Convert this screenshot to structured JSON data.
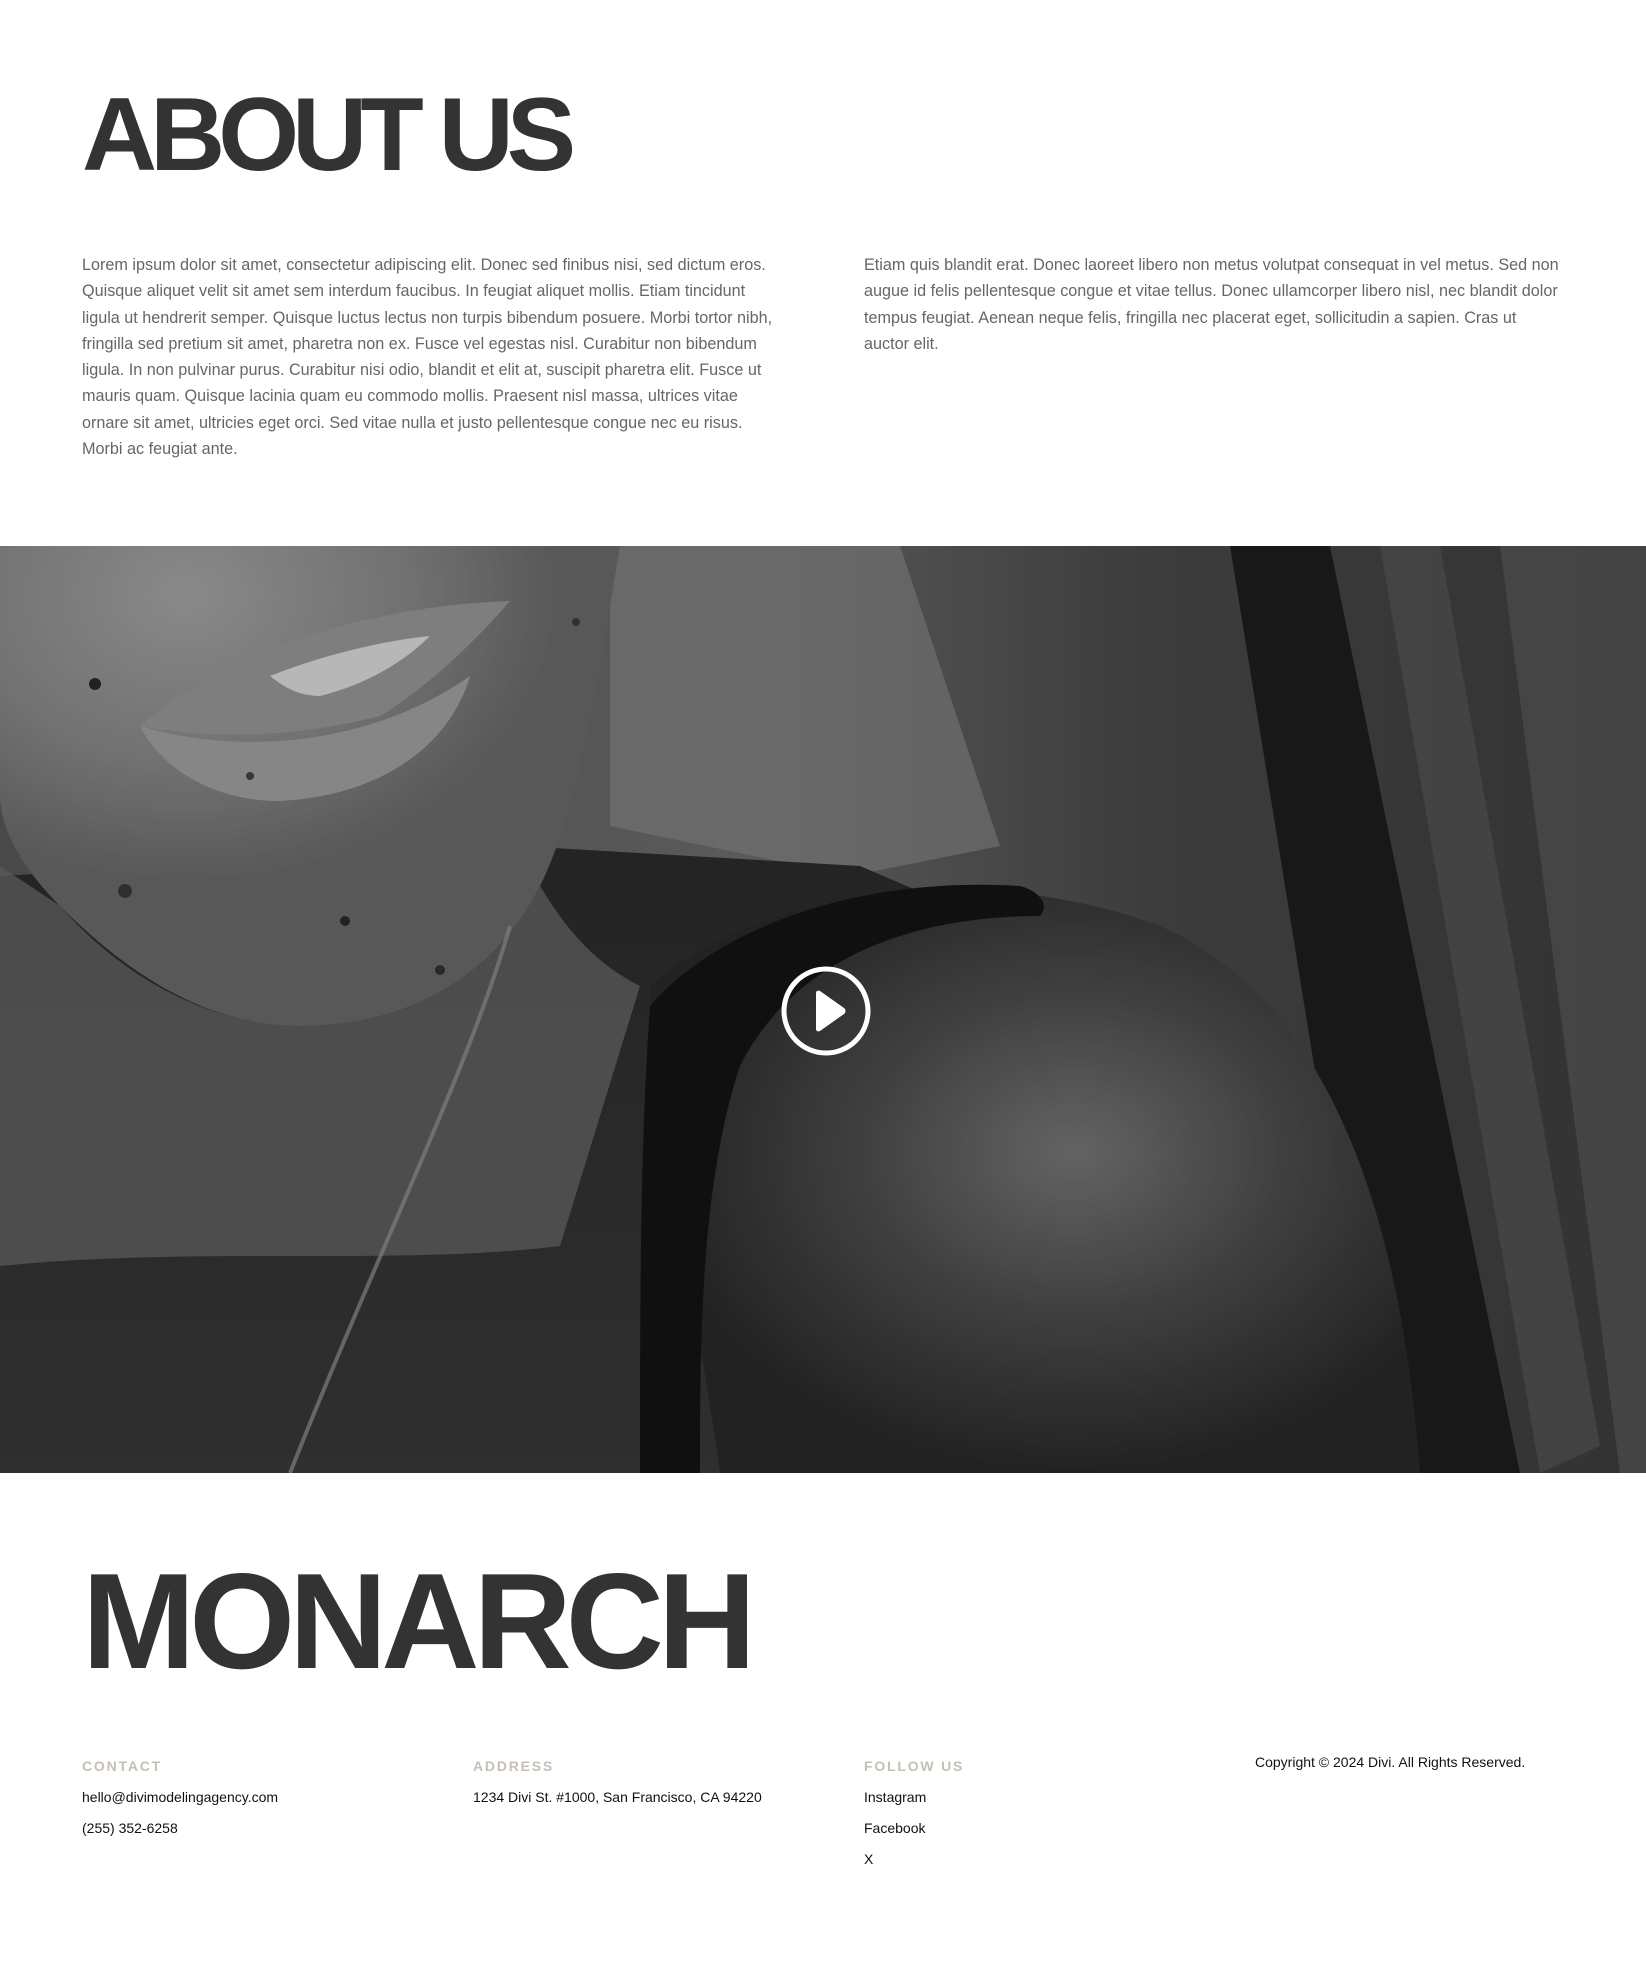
{
  "about": {
    "title": "ABOUT US",
    "left_paragraph": "Lorem ipsum dolor sit amet, consectetur adipiscing elit. Donec sed finibus nisi, sed dictum eros. Quisque aliquet velit sit amet sem interdum faucibus. In feugiat aliquet mollis. Etiam tincidunt ligula ut hendrerit semper. Quisque luctus lectus non turpis bibendum posuere. Morbi tortor nibh, fringilla sed pretium sit amet, pharetra non ex. Fusce vel egestas nisl. Curabitur non bibendum ligula. In non pulvinar purus. Curabitur nisi odio, blandit et elit at, suscipit pharetra elit. Fusce ut mauris quam. Quisque lacinia quam eu commodo mollis. Praesent nisl massa, ultrices vitae ornare sit amet, ultricies eget orci. Sed vitae nulla et justo pellentesque congue nec eu risus. Morbi ac feugiat ante.",
    "right_paragraph": "Etiam quis blandit erat. Donec laoreet libero non metus volutpat consequat in vel metus. Sed non augue id felis pellentesque congue et vitae tellus. Donec ullamcorper libero nisl, nec blandit dolor tempus feugiat. Aenean neque felis, fringilla nec placerat eget, sollicitudin a sapien. Cras ut auctor elit."
  },
  "video": {
    "play_icon": "play-circle-icon"
  },
  "footer": {
    "brand": "MONARCH",
    "contact": {
      "heading": "CONTACT",
      "email": "hello@divimodelingagency.com",
      "phone": "(255) 352-6258"
    },
    "address": {
      "heading": "ADDRESS",
      "line": "1234 Divi St. #1000, San Francisco, CA 94220"
    },
    "follow": {
      "heading": "FOLLOW US",
      "links": [
        "Instagram",
        "Facebook",
        "X"
      ]
    },
    "copyright": "Copyright © 2024 Divi. All Rights Reserved."
  },
  "colors": {
    "heading_text": "#333333",
    "body_text": "#666666",
    "footer_heading": "#c5bfb6",
    "footer_text": "#111111"
  }
}
